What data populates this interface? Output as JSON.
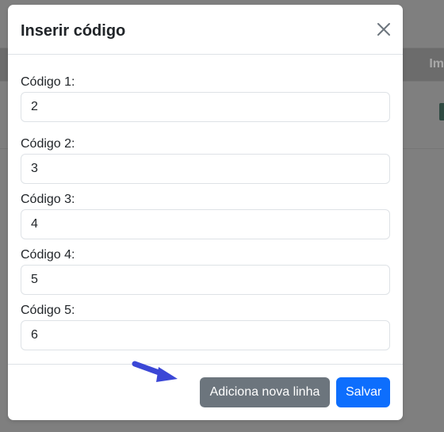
{
  "background": {
    "header_partial_text": "Im"
  },
  "modal": {
    "title": "Inserir código",
    "fields": [
      {
        "label": "Código 1:",
        "value": "2"
      },
      {
        "label": "Código 2:",
        "value": "3"
      },
      {
        "label": "Código 3:",
        "value": "4"
      },
      {
        "label": "Código 4:",
        "value": "5"
      },
      {
        "label": "Código 5:",
        "value": "6"
      }
    ],
    "buttons": {
      "add_line": "Adiciona nova linha",
      "save": "Salvar"
    }
  },
  "colors": {
    "primary": "#0d6efd",
    "secondary": "#6c757d",
    "arrow": "#3b47d6"
  },
  "icons": {
    "close": "close-icon",
    "annotation": "annotation-arrow-icon"
  }
}
